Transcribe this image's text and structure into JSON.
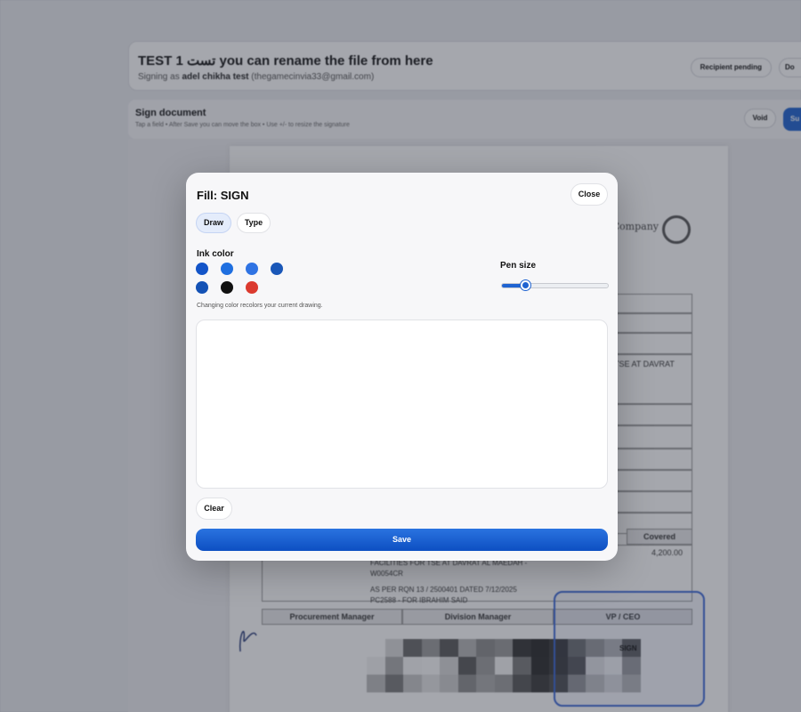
{
  "header": {
    "title": "TEST 1 تست you can rename the file from here",
    "signing_as_prefix": "Signing as",
    "signer_name": "adel chikha test",
    "signer_email": "(thegamecinvia33@gmail.com)",
    "recipient_status": "Recipient pending",
    "doc_button": "Do"
  },
  "signbar": {
    "title": "Sign document",
    "hint": "Tap a field • After Save you can move the box • Use +/- to resize the signature",
    "void_label": "Void",
    "submit_label": "Su"
  },
  "document": {
    "company_word": "Company",
    "text_tse": "TSE AT DAVRAT",
    "col_header_cost": "Covered",
    "amount": "4,200.00",
    "line1": "FACILITIES FOR TSE AT DAVRAT AL MAEDAH -",
    "line2": "W0054CR",
    "line3": "AS PER RQN 13 / 2500401 DATED 7/12/2025",
    "line4": "PC2588 - FOR IBRAHIM SAID",
    "proc_manager": "Procurement Manager",
    "div_manager": "Division Manager",
    "vp_ceo": "VP / CEO",
    "sign_marker": "SIGN"
  },
  "modal": {
    "title": "Fill: SIGN",
    "close_label": "Close",
    "tabs": [
      {
        "label": "Draw",
        "active": true
      },
      {
        "label": "Type",
        "active": false
      }
    ],
    "ink_color_label": "Ink color",
    "ink_colors": [
      "#1354c8",
      "#1f6fe0",
      "#2f73e3",
      "#1a57b8",
      "#1452b5",
      "#111111",
      "#db3a2f"
    ],
    "ink_hint": "Changing color recolors your current drawing.",
    "pen_size_label": "Pen size",
    "pen_size_value": 0.22,
    "clear_label": "Clear",
    "save_label": "Save"
  }
}
